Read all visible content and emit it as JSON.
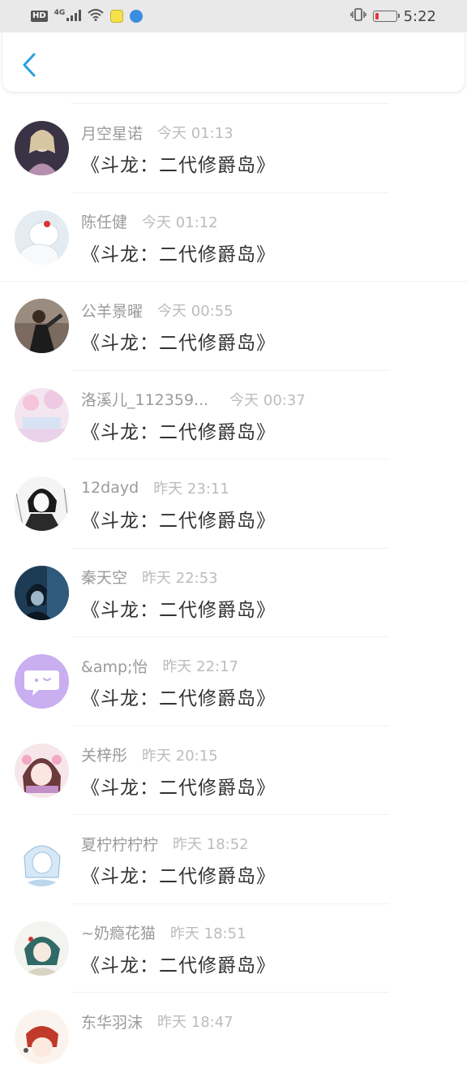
{
  "status_bar": {
    "hd": "HD",
    "network": "4G",
    "time": "5:22",
    "icons": [
      "hd-icon",
      "signal-icon",
      "wifi-icon",
      "app-notify-icon",
      "app-notify-icon-2",
      "vibrate-icon",
      "battery-icon"
    ]
  },
  "header": {
    "back_icon": "chevron-left-icon",
    "accent": "#2a9fe0"
  },
  "items": [
    {
      "nick": "月空星诺",
      "time": "今天 01:13",
      "content": "《斗龙：二代修爵岛》"
    },
    {
      "nick": "陈任健",
      "time": "今天 01:12",
      "content": "《斗龙：二代修爵岛》"
    },
    {
      "nick": "公羊景曜",
      "time": "今天 00:55",
      "content": "《斗龙：二代修爵岛》"
    },
    {
      "nick": "洛溪儿_112359...",
      "time": "今天 00:37",
      "content": "《斗龙：二代修爵岛》"
    },
    {
      "nick": "12dayd",
      "time": "昨天 23:11",
      "content": "《斗龙：二代修爵岛》"
    },
    {
      "nick": "秦天空",
      "time": "昨天 22:53",
      "content": "《斗龙：二代修爵岛》"
    },
    {
      "nick": "&amp;怡",
      "time": "昨天 22:17",
      "content": "《斗龙：二代修爵岛》"
    },
    {
      "nick": "关梓彤",
      "time": "昨天 20:15",
      "content": "《斗龙：二代修爵岛》"
    },
    {
      "nick": "夏柠柠柠柠",
      "time": "昨天 18:52",
      "content": "《斗龙：二代修爵岛》"
    },
    {
      "nick": "~奶瘾花猫",
      "time": "昨天 18:51",
      "content": "《斗龙：二代修爵岛》"
    },
    {
      "nick": "东华羽沫",
      "time": "昨天 18:47",
      "content": ""
    }
  ]
}
